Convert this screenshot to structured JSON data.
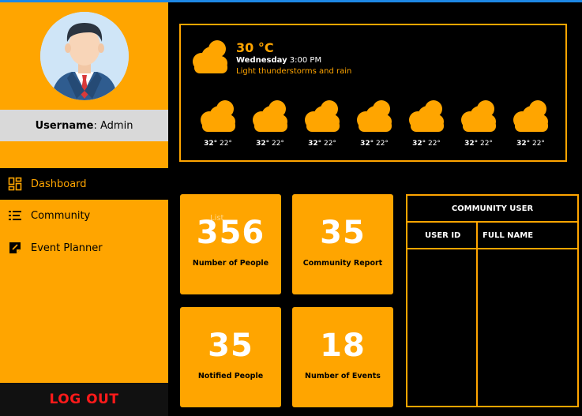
{
  "sidebar": {
    "username_label": "Username",
    "username_value": ": Admin",
    "nav": [
      {
        "label": "Dashboard",
        "icon": "dashboard-grid-icon"
      },
      {
        "label": "Community",
        "icon": "list-icon"
      },
      {
        "label": "Event Planner",
        "icon": "sticky-note-icon"
      }
    ],
    "logout_label": "LOG OUT"
  },
  "weather": {
    "temperature": "30 °C",
    "day": "Wednesday",
    "time": "3:00 PM",
    "description": "Light thunderstorms and rain",
    "forecast": [
      {
        "high": "32°",
        "low": "22°"
      },
      {
        "high": "32°",
        "low": "22°"
      },
      {
        "high": "32°",
        "low": "22°"
      },
      {
        "high": "32°",
        "low": "22°"
      },
      {
        "high": "32°",
        "low": "22°"
      },
      {
        "high": "32°",
        "low": "22°"
      },
      {
        "high": "32°",
        "low": "22°"
      }
    ]
  },
  "stats": [
    {
      "value": "356",
      "label": "Number of People",
      "ghost": "List"
    },
    {
      "value": "35",
      "label": "Community Report"
    },
    {
      "value": "35",
      "label": "Notified People"
    },
    {
      "value": "18",
      "label": "Number of Events"
    }
  ],
  "table": {
    "title": "COMMUNITY USER",
    "columns": [
      "USER ID",
      "FULL NAME"
    ]
  },
  "colors": {
    "accent": "#ffa500",
    "background": "#000000",
    "logout": "#ff1a1a"
  }
}
